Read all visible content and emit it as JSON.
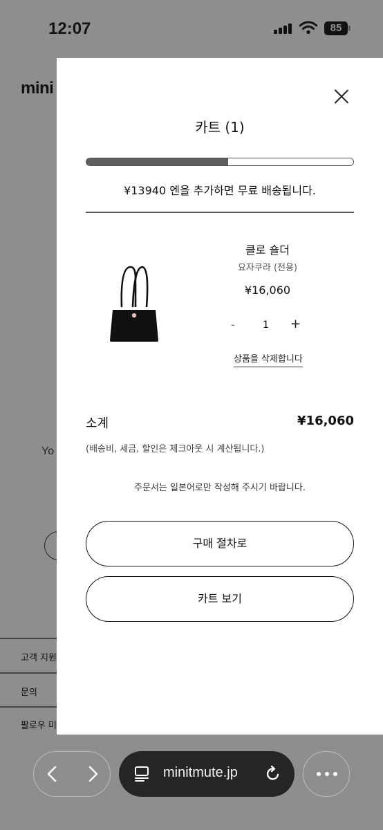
{
  "status_bar": {
    "time": "12:07",
    "battery": "85"
  },
  "background_page": {
    "logo": "mini",
    "partial_text": "Yo",
    "footer_items": [
      "고객 지원",
      "문의",
      "팔로우 미"
    ]
  },
  "cart": {
    "title": "카트 (1)",
    "free_shipping_progress": 0.53,
    "shipping_message": "¥13940 엔을 추가하면 무료 배송됩니다.",
    "item": {
      "name": "클로 숄더",
      "variant": "요자쿠라 (전용)",
      "price": "¥16,060",
      "quantity_minus": "-",
      "quantity": "1",
      "quantity_plus": "+",
      "remove_label": "상품을 삭제합니다"
    },
    "subtotal_label": "소계",
    "subtotal_value": "¥16,060",
    "tax_note": "(배송비, 세금, 할인은 체크아웃 시 계산됩니다.)",
    "language_note": "주문서는 일본어로만 작성해 주시기 바랍니다.",
    "checkout_label": "구매 절차로",
    "view_cart_label": "카트 보기"
  },
  "browser": {
    "url": "minitmute.jp"
  },
  "colors": {
    "overlay_gray": "#8e8e8e",
    "url_bar": "#252525",
    "progress_fill": "#5e5e5e"
  }
}
